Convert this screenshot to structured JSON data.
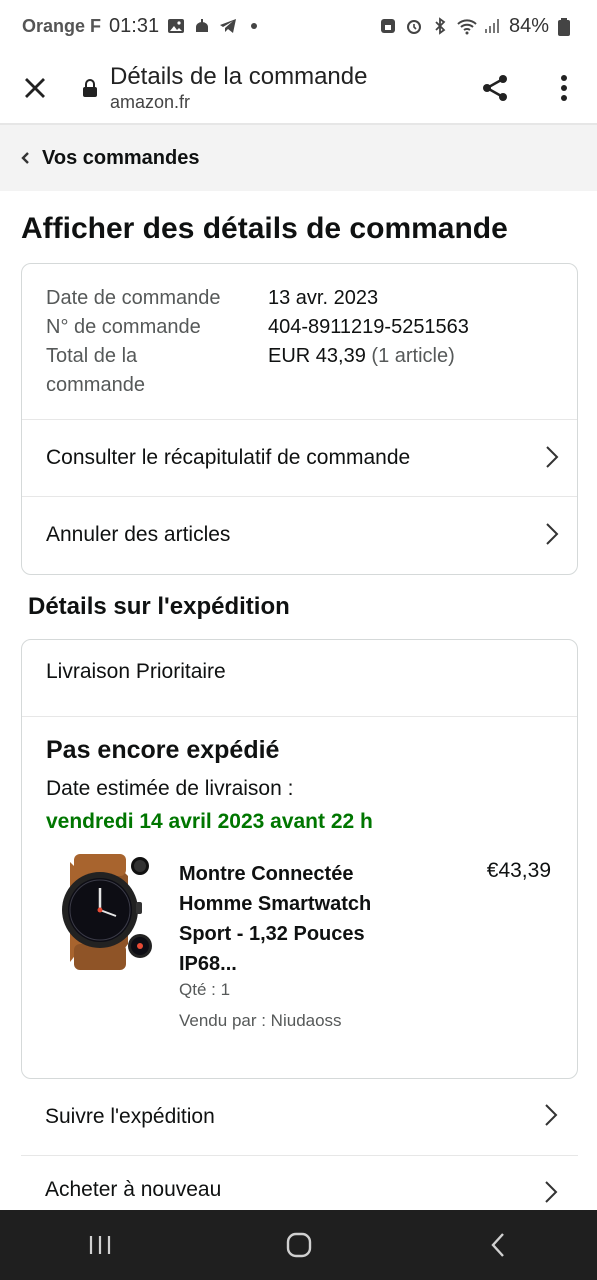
{
  "status_bar": {
    "carrier": "Orange F",
    "time": "01:31",
    "battery": "84%"
  },
  "browser": {
    "title": "Détails de la commande",
    "url": "amazon.fr"
  },
  "breadcrumb": {
    "label": "Vos commandes"
  },
  "page_title": "Afficher des détails de commande",
  "order": {
    "date_label": "Date de commande",
    "date_value": "13 avr. 2023",
    "number_label": "N° de commande",
    "number_value": "404-8911219-5251563",
    "total_label_1": "Total de la",
    "total_label_2": "commande",
    "total_value": "EUR 43,39",
    "total_count": "(1 article)",
    "links": [
      {
        "label": "Consulter le récapitulatif de commande"
      },
      {
        "label": "Annuler des articles"
      }
    ]
  },
  "shipping": {
    "section_title": "Détails sur l'expédition",
    "method": "Livraison Prioritaire",
    "status": "Pas encore expédié",
    "estimate_label": "Date estimée de livraison :",
    "estimate_date": "vendredi 14 avril 2023 avant 22 h",
    "product": {
      "name": "Montre Connectée Homme Smartwatch Sport - 1,32 Pouces IP68...",
      "price": "€43,39",
      "qty": "Qté : 1",
      "seller": "Vendu par : Niudaoss"
    }
  },
  "actions": [
    {
      "label": "Suivre l'expédition"
    },
    {
      "label": "Acheter à nouveau"
    }
  ],
  "colors": {
    "delivery_green": "#007600",
    "navbar": "#1f1f1f",
    "breadcrumb_bg": "#f3f3f3"
  }
}
